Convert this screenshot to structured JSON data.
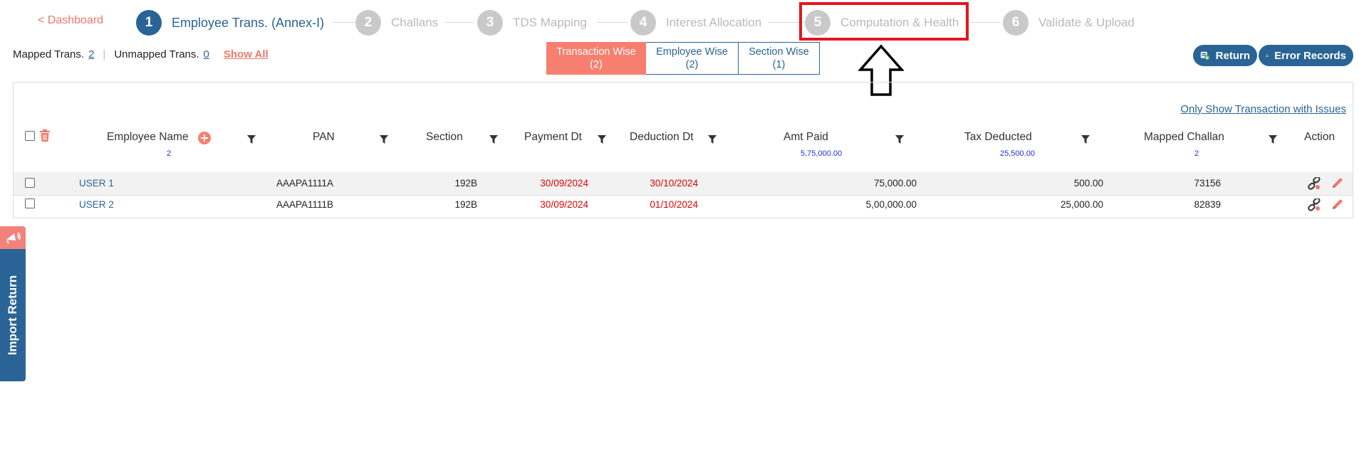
{
  "nav": {
    "back_label": "< Dashboard"
  },
  "steps": [
    {
      "num": "1",
      "label": "Employee Trans. (Annex-I)",
      "state": "active"
    },
    {
      "num": "2",
      "label": "Challans",
      "state": "inactive"
    },
    {
      "num": "3",
      "label": "TDS Mapping",
      "state": "inactive"
    },
    {
      "num": "4",
      "label": "Interest Allocation",
      "state": "inactive"
    },
    {
      "num": "5",
      "label": "Computation & Health",
      "state": "inactive"
    },
    {
      "num": "6",
      "label": "Validate & Upload",
      "state": "inactive"
    }
  ],
  "summary": {
    "mapped_label": "Mapped Trans.",
    "mapped_count": "2",
    "unmapped_label": "Unmapped Trans.",
    "unmapped_count": "0",
    "show_all": "Show All"
  },
  "view_tabs": [
    {
      "label": "Transaction Wise",
      "count": "(2)",
      "active": true
    },
    {
      "label": "Employee Wise",
      "count": "(2)",
      "active": false
    },
    {
      "label": "Section Wise",
      "count": "(1)",
      "active": false
    }
  ],
  "buttons": {
    "return": "Return",
    "error_records": "Error Records"
  },
  "table": {
    "only_issues_link": "Only Show Transaction with Issues",
    "headers": {
      "employee_name": "Employee Name",
      "employee_name_sub": "2",
      "pan": "PAN",
      "section": "Section",
      "payment_dt": "Payment Dt",
      "deduction_dt": "Deduction Dt",
      "amt_paid": "Amt Paid",
      "amt_paid_sub": "5,75,000.00",
      "tax_deducted": "Tax Deducted",
      "tax_deducted_sub": "25,500.00",
      "mapped_challan": "Mapped Challan",
      "mapped_challan_sub": "2",
      "action": "Action"
    },
    "rows": [
      {
        "name": "USER 1",
        "pan": "AAAPA1111A",
        "section": "192B",
        "payment_dt": "30/09/2024",
        "deduction_dt": "30/10/2024",
        "amt_paid": "75,000.00",
        "tax_deducted": "500.00",
        "challan": "73156"
      },
      {
        "name": "USER 2",
        "pan": "AAAPA1111B",
        "section": "192B",
        "payment_dt": "30/09/2024",
        "deduction_dt": "01/10/2024",
        "amt_paid": "5,00,000.00",
        "tax_deducted": "25,000.00",
        "challan": "82839"
      }
    ]
  },
  "side_tab": {
    "label": "Import Return"
  },
  "colors": {
    "primary": "#2a6496",
    "accent": "#f77f70",
    "alert": "#e00000",
    "highlight": "#e3161f"
  }
}
